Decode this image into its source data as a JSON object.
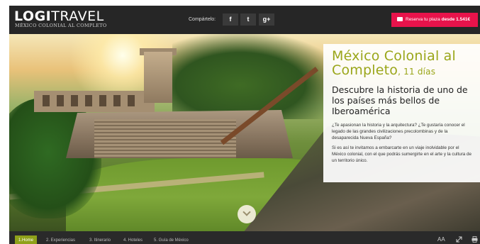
{
  "header": {
    "logo_bold": "LOGI",
    "logo_thin": "TRAVEL",
    "logo_subtitle": "MÉXICO COLONIAL AL COMPLETO",
    "share_label": "Compártelo:",
    "social": [
      {
        "label": "f",
        "icon": "facebook-icon"
      },
      {
        "label": "t",
        "icon": "twitter-icon"
      },
      {
        "label": "g+",
        "icon": "google-plus-icon"
      }
    ],
    "reserve_text": "Reserva tu plaza",
    "reserve_price": "desde 1.541€",
    "reserve_color": "#e8134b"
  },
  "info": {
    "title": "México Colonial al Completo",
    "days": ", 11 días",
    "subtitle": "Descubre la historia de uno de los países más bellos de Iberoamérica",
    "paragraph1": "¿Te apasionan la historia y la arquitectura? ¿Te gustaría conocer el legado de las grandes civilizaciones precolombinas y de la desaparecida Nueva España?",
    "paragraph2": "Si es así te invitamos a embarcarte en un viaje inolvidable por el México colonial, con el que podrás sumergirte en el arte y la cultura de un territorio único.",
    "title_color": "#9aa61a"
  },
  "nav": {
    "items": [
      {
        "label": "1.Home",
        "active": true
      },
      {
        "label": "2. Experiencias"
      },
      {
        "label": "3. Itinerario"
      },
      {
        "label": "4. Hoteles"
      },
      {
        "label": "5. Guía de México"
      }
    ],
    "controls": {
      "font_size": "AA",
      "fullscreen_icon": "expand-icon",
      "print_icon": "print-icon"
    },
    "active_color": "#8fa11a"
  }
}
